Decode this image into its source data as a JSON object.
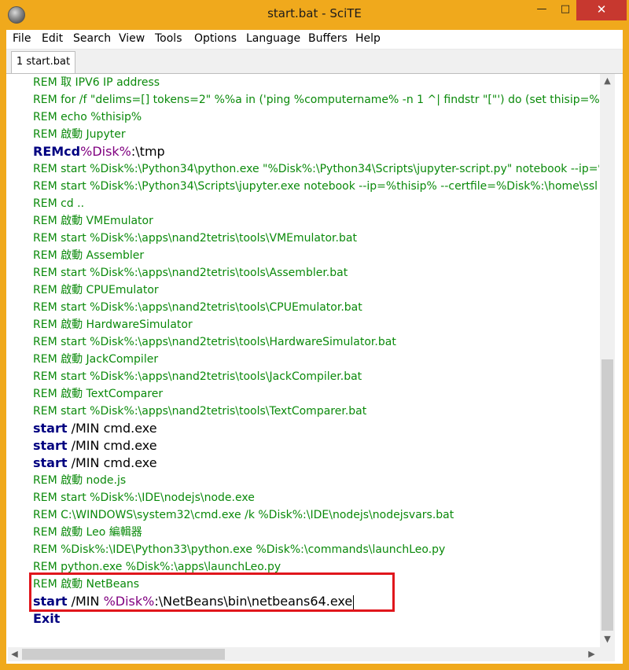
{
  "window": {
    "title": "start.bat - SciTE",
    "minimize_glyph": "—",
    "maximize_glyph": "□",
    "close_glyph": "✕",
    "app_icon": "scite-sphere-icon",
    "accent_color": "#f0a91c",
    "close_color": "#c7382f"
  },
  "menu": [
    "File",
    "Edit",
    "Search",
    "View",
    "Tools",
    "Options",
    "Language",
    "Buffers",
    "Help"
  ],
  "tabs": [
    {
      "label": "1 start.bat"
    }
  ],
  "editor": {
    "lines": [
      {
        "text": "REM 取 IPV6 IP address"
      },
      {
        "text": "REM for /f \"delims=[] tokens=2\" %%a in ('ping %computername% -n 1 ^| findstr \"[\"') do (set thisip=%%a)"
      },
      {
        "text": "REM echo %thisip%"
      },
      {
        "text": "REM 啟動 Jupyter"
      },
      {
        "kw": "REMcd",
        "var": "%Disk%",
        "rest": ":\\tmp"
      },
      {
        "text": "REM start %Disk%:\\Python34\\python.exe \"%Disk%:\\Python34\\Scripts\\jupyter-script.py\" notebook --ip=%thisip%"
      },
      {
        "text": "REM start %Disk%:\\Python34\\Scripts\\jupyter.exe notebook --ip=%thisip% --certfile=%Disk%:\\home\\ssl"
      },
      {
        "text": "REM cd .."
      },
      {
        "text": "REM 啟動 VMEmulator"
      },
      {
        "text": "REM start %Disk%:\\apps\\nand2tetris\\tools\\VMEmulator.bat"
      },
      {
        "text": "REM 啟動 Assembler"
      },
      {
        "text": "REM start %Disk%:\\apps\\nand2tetris\\tools\\Assembler.bat"
      },
      {
        "text": "REM 啟動 CPUEmulator"
      },
      {
        "text": "REM start %Disk%:\\apps\\nand2tetris\\tools\\CPUEmulator.bat"
      },
      {
        "text": "REM 啟動 HardwareSimulator"
      },
      {
        "text": "REM start %Disk%:\\apps\\nand2tetris\\tools\\HardwareSimulator.bat"
      },
      {
        "text": "REM 啟動 JackCompiler"
      },
      {
        "text": "REM start %Disk%:\\apps\\nand2tetris\\tools\\JackCompiler.bat"
      },
      {
        "text": "REM 啟動 TextComparer"
      },
      {
        "text": "REM start %Disk%:\\apps\\nand2tetris\\tools\\TextComparer.bat"
      },
      {
        "kw": "start",
        "rest": " /MIN cmd.exe"
      },
      {
        "kw": "start",
        "rest": " /MIN cmd.exe"
      },
      {
        "kw": "start",
        "rest": " /MIN cmd.exe"
      },
      {
        "text": "REM 啟動 node.js"
      },
      {
        "text": "REM start %Disk%:\\IDE\\nodejs\\node.exe"
      },
      {
        "text": "REM C:\\WINDOWS\\system32\\cmd.exe /k %Disk%:\\IDE\\nodejs\\nodejsvars.bat"
      },
      {
        "text": "REM 啟動 Leo 編輯器"
      },
      {
        "text": "REM %Disk%:\\IDE\\Python33\\python.exe %Disk%:\\commands\\launchLeo.py"
      },
      {
        "text": "REM python.exe %Disk%:\\apps\\launchLeo.py"
      },
      {
        "text": "REM 啟動  NetBeans"
      },
      {
        "kw": "start",
        "mid": " /MIN ",
        "var": "%Disk%",
        "rest": ":\\NetBeans\\bin\\netbeans64.exe",
        "caret": true
      },
      {
        "kw": "Exit"
      }
    ]
  },
  "scrollbars": {
    "up_glyph": "▲",
    "down_glyph": "▼",
    "left_glyph": "◀",
    "right_glyph": "▶"
  },
  "highlight_color": "#e0161c"
}
